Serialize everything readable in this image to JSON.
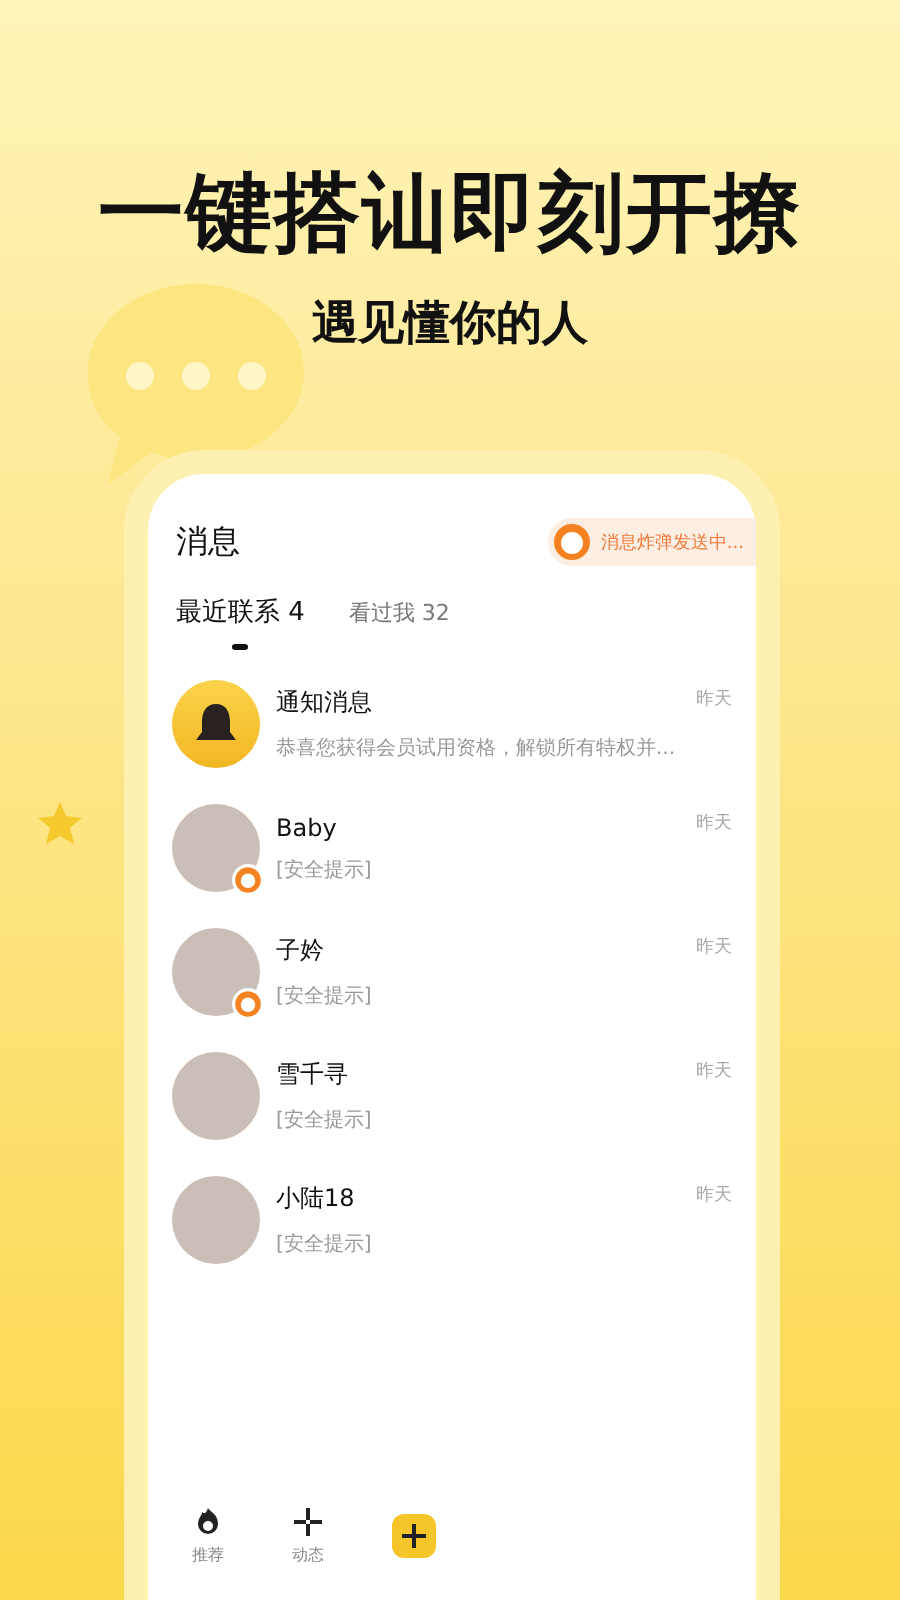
{
  "headline": "一键搭讪即刻开撩",
  "subline": "遇见懂你的人",
  "screen": {
    "title": "消息",
    "banner": "消息炸弹发送中...",
    "tabs": [
      {
        "label": "最近联系 4",
        "selected": true
      },
      {
        "label": "看过我 32",
        "selected": false
      }
    ],
    "conversations": [
      {
        "kind": "notice",
        "name": "通知消息",
        "preview": "恭喜您获得会员试用资格，解锁所有特权并...",
        "time": "昨天",
        "badge": false
      },
      {
        "kind": "person",
        "name": "Baby",
        "preview": "[安全提示]",
        "time": "昨天",
        "badge": true
      },
      {
        "kind": "person",
        "name": "子妗",
        "preview": "[安全提示]",
        "time": "昨天",
        "badge": true
      },
      {
        "kind": "person",
        "name": "雪千寻",
        "preview": "[安全提示]",
        "time": "昨天",
        "badge": false
      },
      {
        "kind": "person",
        "name": "小陆18",
        "preview": "[安全提示]",
        "time": "昨天",
        "badge": false
      }
    ],
    "nav": [
      {
        "kind": "flame",
        "label": "推荐"
      },
      {
        "kind": "pinwheel",
        "label": "动态"
      },
      {
        "kind": "plus"
      }
    ]
  }
}
